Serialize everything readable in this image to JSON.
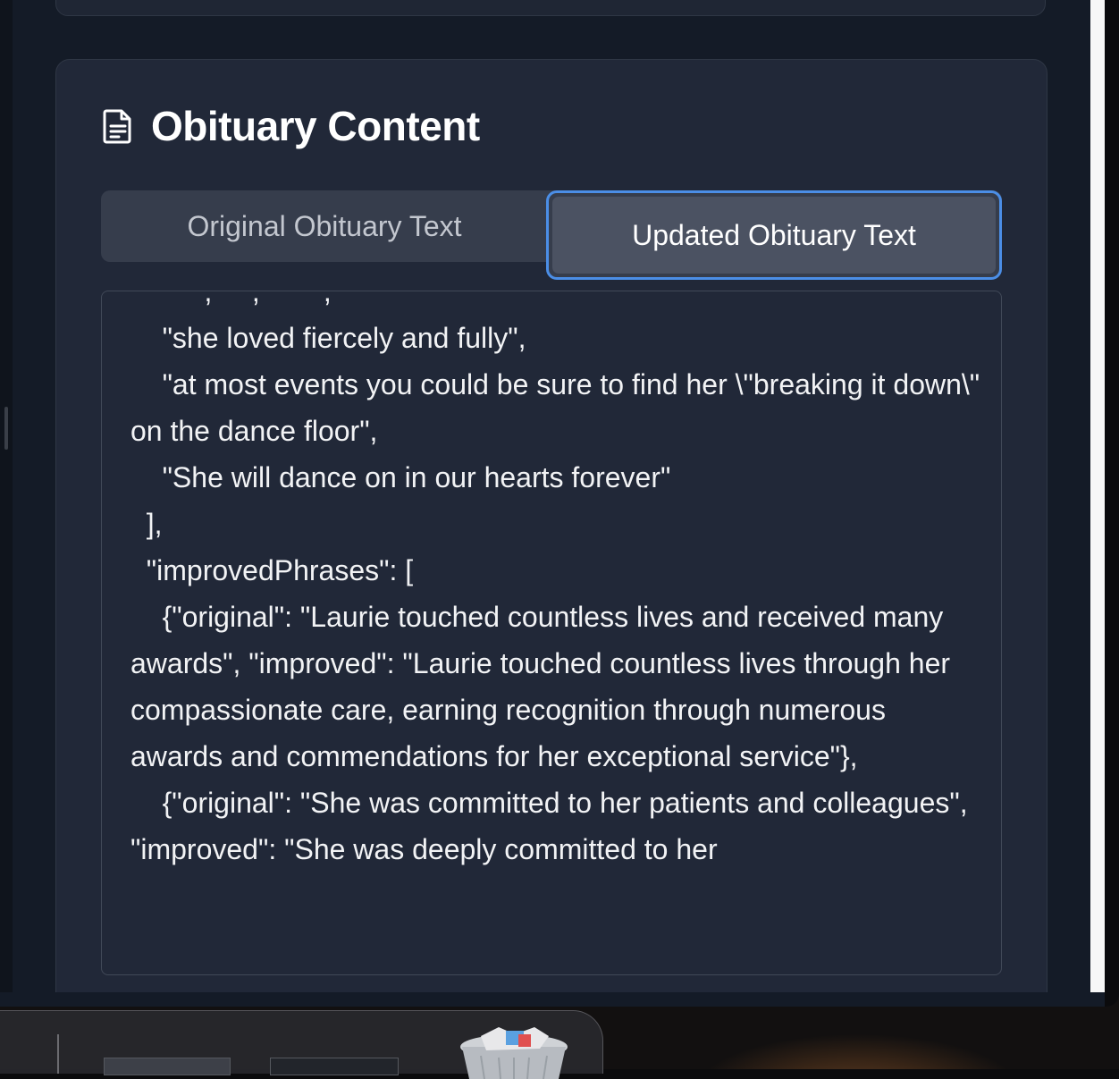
{
  "card": {
    "title": "Obituary Content",
    "icon": "document-icon"
  },
  "tabs": [
    {
      "label": "Original Obituary Text",
      "active": false
    },
    {
      "label": "Updated Obituary Text",
      "active": true
    }
  ],
  "content_lines": [
    "    \"she loved fiercely and fully\",",
    "    \"at most events you could be sure to find her \\\"breaking it down\\\" on the dance floor\",",
    "    \"She will dance on in our hearts forever\"",
    "  ],",
    "  \"improvedPhrases\": [",
    "    {\"original\": \"Laurie touched countless lives and received many awards\", \"improved\": \"Laurie touched countless lives through her compassionate care, earning recognition through numerous awards and commendations for her exceptional service\"},",
    "    {\"original\": \"She was committed to her patients and colleagues\", \"improved\": \"She was deeply committed to her"
  ],
  "dock": {
    "trash_icon": "trash-icon"
  },
  "colors": {
    "accent": "#4b8ee6",
    "card_bg": "#212838",
    "page_bg": "#141b27"
  }
}
